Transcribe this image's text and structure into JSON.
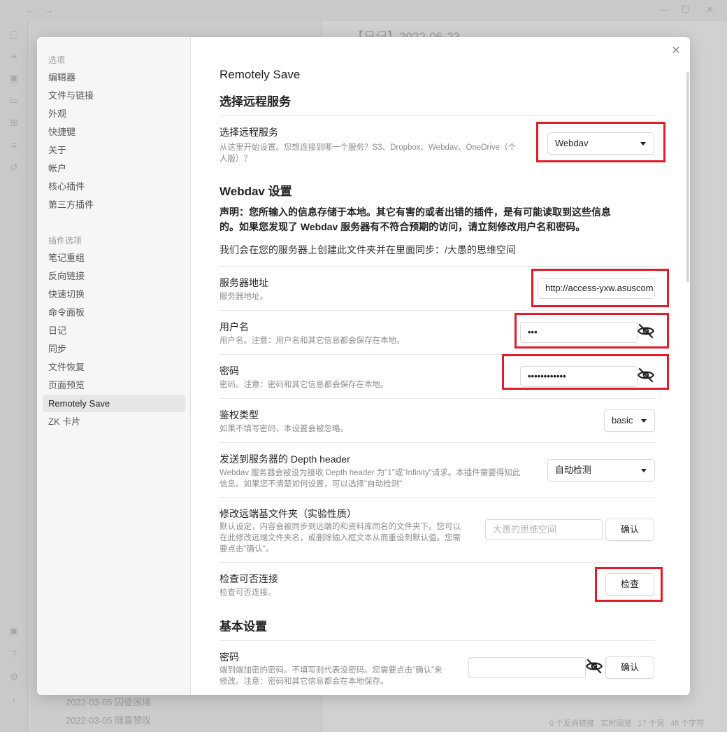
{
  "background": {
    "title": "【日记】2022-06-23",
    "list_items": [
      "2022-03-05 囚徒困境",
      "2022-03-05 随喜赞叹"
    ],
    "status": {
      "backlinks": "0 个反向链接",
      "preview": "实时阅览",
      "lines": "17 个词",
      "chars": "45 个字符"
    }
  },
  "sidebar": {
    "options_header": "选项",
    "options": [
      "编辑器",
      "文件与链接",
      "外观",
      "快捷键",
      "关于",
      "帐户",
      "核心插件",
      "第三方插件"
    ],
    "plugin_header": "插件选项",
    "plugins": [
      "笔记重组",
      "反向链接",
      "快速切换",
      "命令面板",
      "日记",
      "同步",
      "文件恢复",
      "页面预览",
      "Remotely Save",
      "ZK 卡片"
    ],
    "active": "Remotely Save"
  },
  "content": {
    "plugin_title": "Remotely Save",
    "section_remote": "选择远程服务",
    "remote_service": {
      "name": "选择远程服务",
      "desc_line1": "从这里开始设置。您想连接到哪一个服务？S3、Dropbox、Webdav、OneDrive（个",
      "desc_line2": "人版）？",
      "value": "Webdav"
    },
    "section_webdav": "Webdav 设置",
    "notice_line1": "声明：您所输入的信息存储于本地。其它有害的或者出错的插件，是有可能读取到这些信息",
    "notice_line2": "的。如果您发现了 Webdav 服务器有不符合预期的访问，请立刻修改用户名和密码。",
    "sync_folder_note": "我们会在您的服务器上创建此文件夹并在里面同步：/大愚的思维空间",
    "server": {
      "name": "服务器地址",
      "desc": "服务器地址。",
      "value": "http://access-yxw.asuscom"
    },
    "username": {
      "name": "用户名",
      "desc": "用户名。注意：用户名和其它信息都会保存在本地。",
      "value": "•••"
    },
    "password": {
      "name": "密码",
      "desc": "密码。注意：密码和其它信息都会保存在本地。",
      "value": "••••••••••••"
    },
    "auth": {
      "name": "鉴权类型",
      "desc": "如果不填写密码，本设置会被忽略。",
      "value": "basic"
    },
    "depth": {
      "name": "发送到服务器的 Depth header",
      "desc_line1": "Webdav 服务器会被设为接收 Depth header 为\"1\"或\"Infinity\"请求。本插件需要得知此",
      "desc_line2": "信息。如果您不清楚如何设置，可以选择\"自动检测\"",
      "value": "自动检测"
    },
    "remote_base": {
      "name": "修改远端基文件夹（实验性质）",
      "desc_line1": "默认设定，内容会被同步到远端的和资料库同名的文件夹下。您可以",
      "desc_line2": "在此修改远端文件夹名，或删除输入框文本从而重设到默认值。您需",
      "desc_line3": "要点击\"确认\"。",
      "placeholder": "大愚的思维空间",
      "confirm": "确认"
    },
    "check": {
      "name": "检查可否连接",
      "desc": "检查可否连接。",
      "button": "检查"
    },
    "section_basic": "基本设置",
    "encrypt": {
      "name": "密码",
      "desc_line1": "端到端加密的密码。不填写则代表没密码。您需要点击\"确认\"来",
      "desc_line2": "修改。注意：密码和其它信息都会在本地保存。",
      "confirm": "确认"
    }
  },
  "colors": {
    "highlight": "#e01e2b",
    "active_item_bg": "#e6e6e6"
  }
}
